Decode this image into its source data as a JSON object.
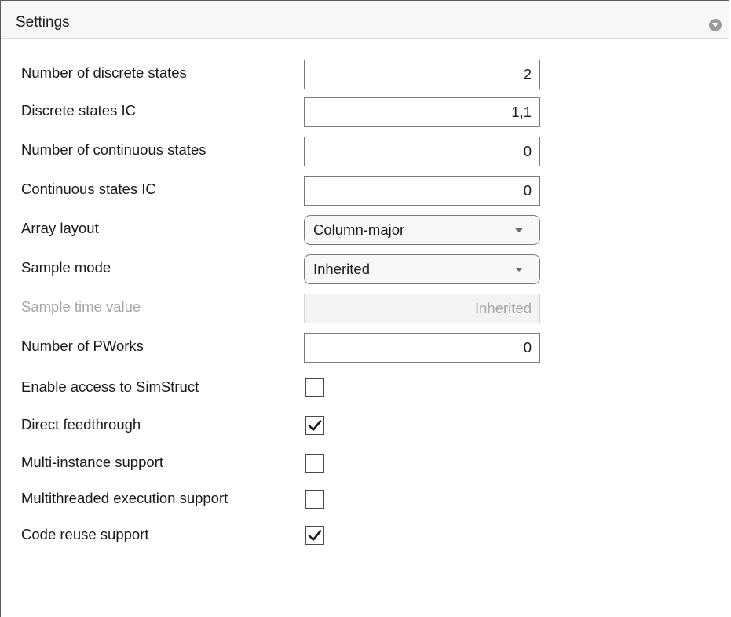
{
  "panel": {
    "title": "Settings",
    "collapse_icon": "chevron-down-circle-icon"
  },
  "fields": {
    "num_discrete_states": {
      "label": "Number of discrete states",
      "value": "2"
    },
    "discrete_states_ic": {
      "label": "Discrete states IC",
      "value": "1,1"
    },
    "num_continuous_states": {
      "label": "Number of continuous states",
      "value": "0"
    },
    "continuous_states_ic": {
      "label": "Continuous states IC",
      "value": "0"
    },
    "array_layout": {
      "label": "Array layout",
      "value": "Column-major"
    },
    "sample_mode": {
      "label": "Sample mode",
      "value": "Inherited"
    },
    "sample_time_value": {
      "label": "Sample time value",
      "value": "Inherited",
      "disabled": true
    },
    "num_pworks": {
      "label": "Number of PWorks",
      "value": "0"
    }
  },
  "checkboxes": {
    "simstruct_access": {
      "label": "Enable access to SimStruct",
      "checked": false
    },
    "direct_feedthrough": {
      "label": "Direct feedthrough",
      "checked": true
    },
    "multi_instance": {
      "label": "Multi-instance support",
      "checked": false
    },
    "multithreaded": {
      "label": "Multithreaded execution support",
      "checked": false
    },
    "code_reuse": {
      "label": "Code reuse support",
      "checked": true
    }
  },
  "colors": {
    "text": "#1a1a1a",
    "disabled_text": "#a6a6a6",
    "border": "#7a7a7a",
    "header_bg": "#f7f7f7"
  }
}
